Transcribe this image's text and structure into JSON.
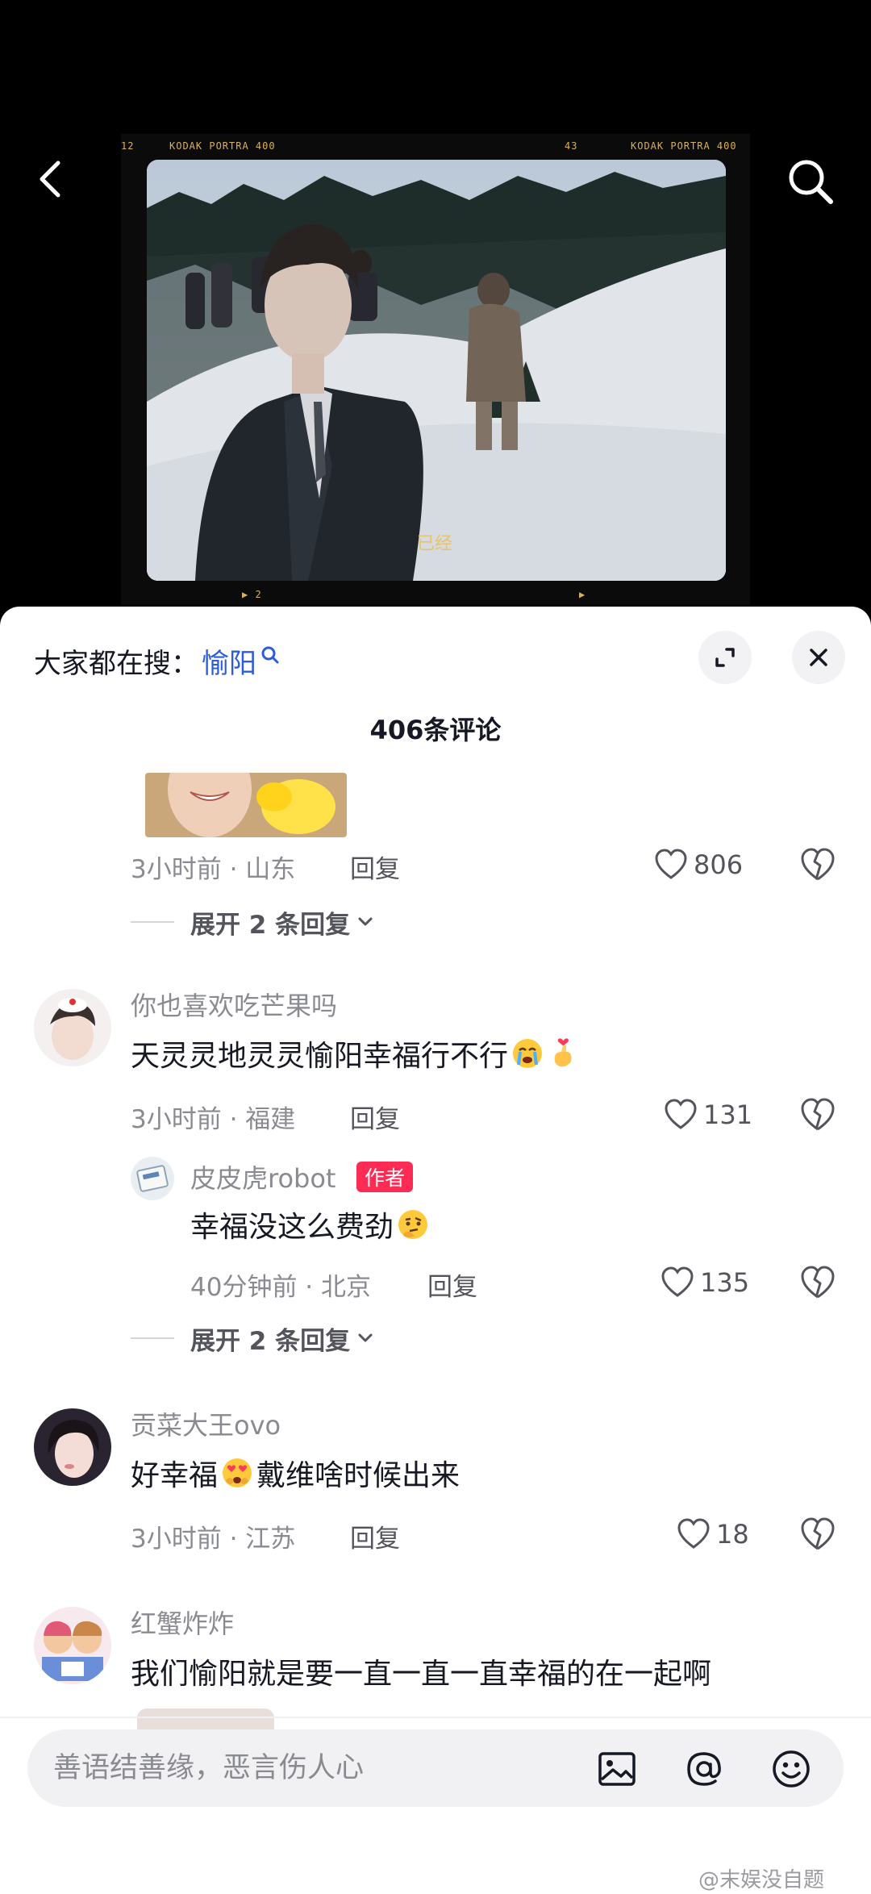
{
  "video": {
    "film_labels": {
      "left_number": "12",
      "left_brand": "KODAK  PORTRA 400",
      "center_number": "43",
      "right_brand": "KODAK  PORTRA 400",
      "bottom_left": "▶ 2",
      "bottom_right": "▶"
    },
    "subtitle": "已经"
  },
  "sheet": {
    "hot_search_label": "大家都在搜：",
    "hot_search_term": "愉阳",
    "comment_count": "406条评论"
  },
  "comments": {
    "c0": {
      "meta": "3小时前 · 山东",
      "reply": "回复",
      "likes": "806",
      "expand": "展开 2 条回复"
    },
    "c1": {
      "username": "你也喜欢吃芒果吗",
      "text": "天灵灵地灵灵愉阳幸福行不行",
      "meta": "3小时前 · 福建",
      "reply": "回复",
      "likes": "131",
      "sub": {
        "username": "皮皮虎robot",
        "badge": "作者",
        "text": "幸福没这么费劲",
        "meta": "40分钟前 · 北京",
        "reply": "回复",
        "likes": "135"
      },
      "expand": "展开 2 条回复"
    },
    "c2": {
      "username": "贡菜大王ovo",
      "text_before": "好幸福",
      "text_after": "戴维啥时候出来",
      "meta": "3小时前 · 江苏",
      "reply": "回复",
      "likes": "18"
    },
    "c3": {
      "username": "红蟹炸炸",
      "text": "我们愉阳就是要一直一直一直幸福的在一起啊"
    }
  },
  "input": {
    "placeholder": "善语结善缘，恶言伤人心"
  },
  "watermark": "@末娱没自题",
  "colors": {
    "accent_link": "#2b5cd9",
    "author_badge": "#fe2c55",
    "muted_text": "#8a8b91"
  },
  "icons": [
    "back-icon",
    "search-icon",
    "expand-icon",
    "close-icon",
    "heart-icon",
    "broken-heart-icon",
    "chevron-down-icon",
    "image-icon",
    "at-icon",
    "emoji-icon"
  ]
}
